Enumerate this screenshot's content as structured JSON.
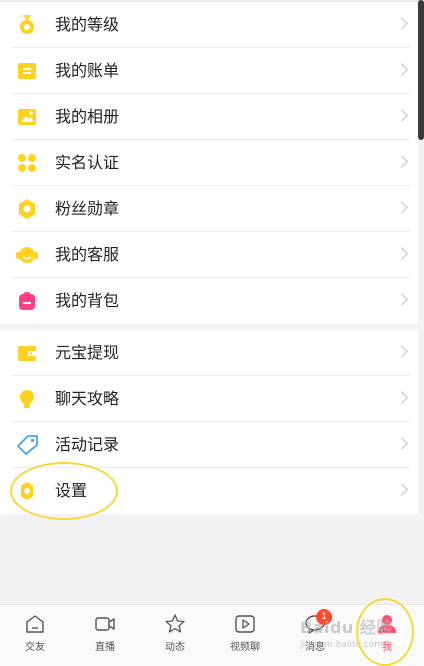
{
  "menu_group_1": [
    {
      "label": "我的等级",
      "icon": "medal-icon"
    },
    {
      "label": "我的账单",
      "icon": "bill-icon"
    },
    {
      "label": "我的相册",
      "icon": "album-icon"
    },
    {
      "label": "实名认证",
      "icon": "verify-grid-icon"
    },
    {
      "label": "粉丝勋章",
      "icon": "badge-hexagon-icon"
    },
    {
      "label": "我的客服",
      "icon": "customer-service-icon"
    },
    {
      "label": "我的背包",
      "icon": "backpack-icon"
    }
  ],
  "menu_group_2": [
    {
      "label": "元宝提现",
      "icon": "wallet-icon"
    },
    {
      "label": "聊天攻略",
      "icon": "lightbulb-icon"
    },
    {
      "label": "活动记录",
      "icon": "tag-icon"
    },
    {
      "label": "设置",
      "icon": "settings-gear-icon"
    }
  ],
  "tabbar": [
    {
      "label": "交友",
      "icon": "home-icon"
    },
    {
      "label": "直播",
      "icon": "live-camera-icon"
    },
    {
      "label": "动态",
      "icon": "star-icon"
    },
    {
      "label": "视频聊",
      "icon": "video-play-icon"
    },
    {
      "label": "消息",
      "icon": "message-icon",
      "badge": "1"
    },
    {
      "label": "我",
      "icon": "profile-icon",
      "active": true
    }
  ],
  "watermark": {
    "text": "Baidu 经验",
    "url": "jingyan.baidu.com"
  },
  "colors": {
    "accent_yellow": "#ffd21f",
    "backpack_pink": "#ff3f7f",
    "active_tab": "#ff4d6d",
    "badge": "#ff4a2d",
    "highlight": "#f4d93a"
  }
}
